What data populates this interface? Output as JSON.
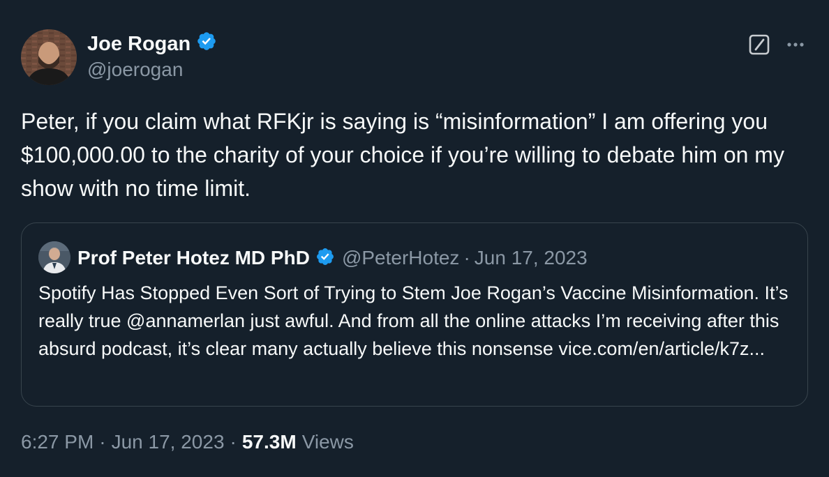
{
  "author": {
    "name": "Joe Rogan",
    "handle": "@joerogan",
    "verified_icon": "verified-badge-icon",
    "avatar_icon": "avatar-photo"
  },
  "actions": {
    "grok_icon": "grok-icon",
    "more_icon": "more-options-icon"
  },
  "tweet": {
    "text": "Peter, if you claim what RFKjr is saying is “misinformation” I am offering you $100,000.00 to the charity of your choice if you’re willing to debate him on my show with no time limit."
  },
  "quote": {
    "name": "Prof Peter Hotez MD PhD",
    "handle": "@PeterHotez",
    "separator": "·",
    "date": "Jun 17, 2023",
    "text": "Spotify Has Stopped Even Sort of Trying to Stem Joe Rogan’s Vaccine Misinformation. It’s really true @annamerlan just awful. And from all the online attacks I’m receiving after this absurd podcast, it’s clear many actually believe this nonsense vice.com/en/article/k7z..."
  },
  "meta": {
    "time": "6:27 PM",
    "separator": "·",
    "date": "Jun 17, 2023",
    "views_count": "57.3M",
    "views_label": "Views"
  },
  "colors": {
    "background": "#15202b",
    "text": "#f7f9f9",
    "secondary": "#8b98a5",
    "border": "#38444d",
    "verified": "#1d9bf0"
  }
}
